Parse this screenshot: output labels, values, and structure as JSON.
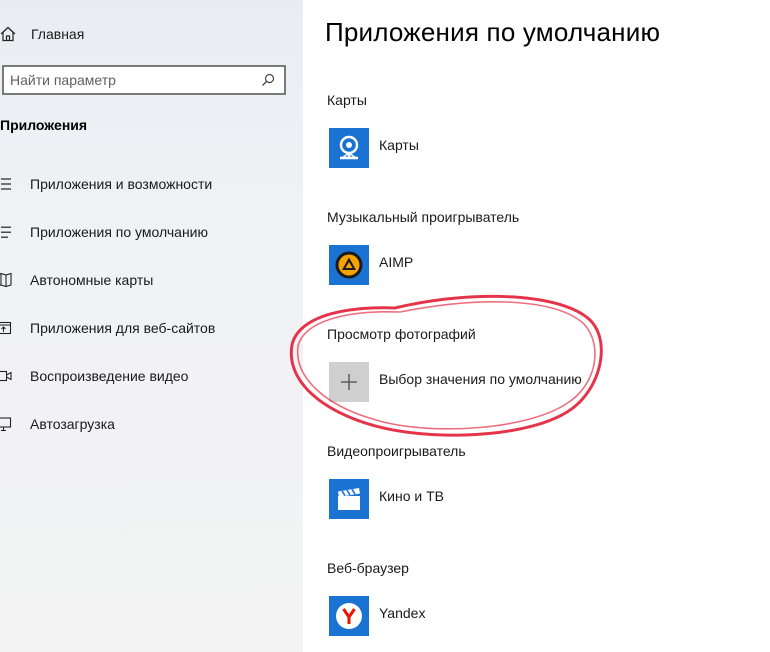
{
  "sidebar": {
    "home_label": "Главная",
    "search": {
      "placeholder": "Найти параметр"
    },
    "section_title": "Приложения",
    "items": [
      {
        "label": "Приложения и возможности",
        "icon": "list-icon"
      },
      {
        "label": "Приложения по умолчанию",
        "icon": "default-list-icon"
      },
      {
        "label": "Автономные карты",
        "icon": "map-icon"
      },
      {
        "label": "Приложения для веб-сайтов",
        "icon": "web-apps-icon"
      },
      {
        "label": "Воспроизведение видео",
        "icon": "video-icon"
      },
      {
        "label": "Автозагрузка",
        "icon": "startup-icon"
      }
    ]
  },
  "main": {
    "title": "Приложения по умолчанию",
    "categories": [
      {
        "label": "Карты",
        "app": "Карты",
        "icon": "maps-app-icon"
      },
      {
        "label": "Музыкальный проигрыватель",
        "app": "AIMP",
        "icon": "aimp-icon"
      },
      {
        "label": "Просмотр фотографий",
        "app": "Выбор значения по умолчанию",
        "icon": "plus-icon"
      },
      {
        "label": "Видеопроигрыватель",
        "app": "Кино и ТВ",
        "icon": "clapper-icon"
      },
      {
        "label": "Веб-браузер",
        "app": "Yandex",
        "icon": "yandex-icon"
      }
    ]
  },
  "colors": {
    "tile_blue": "#1a73d2",
    "tile_gray": "#cfcfcf",
    "annotation_red": "#e0102a"
  }
}
